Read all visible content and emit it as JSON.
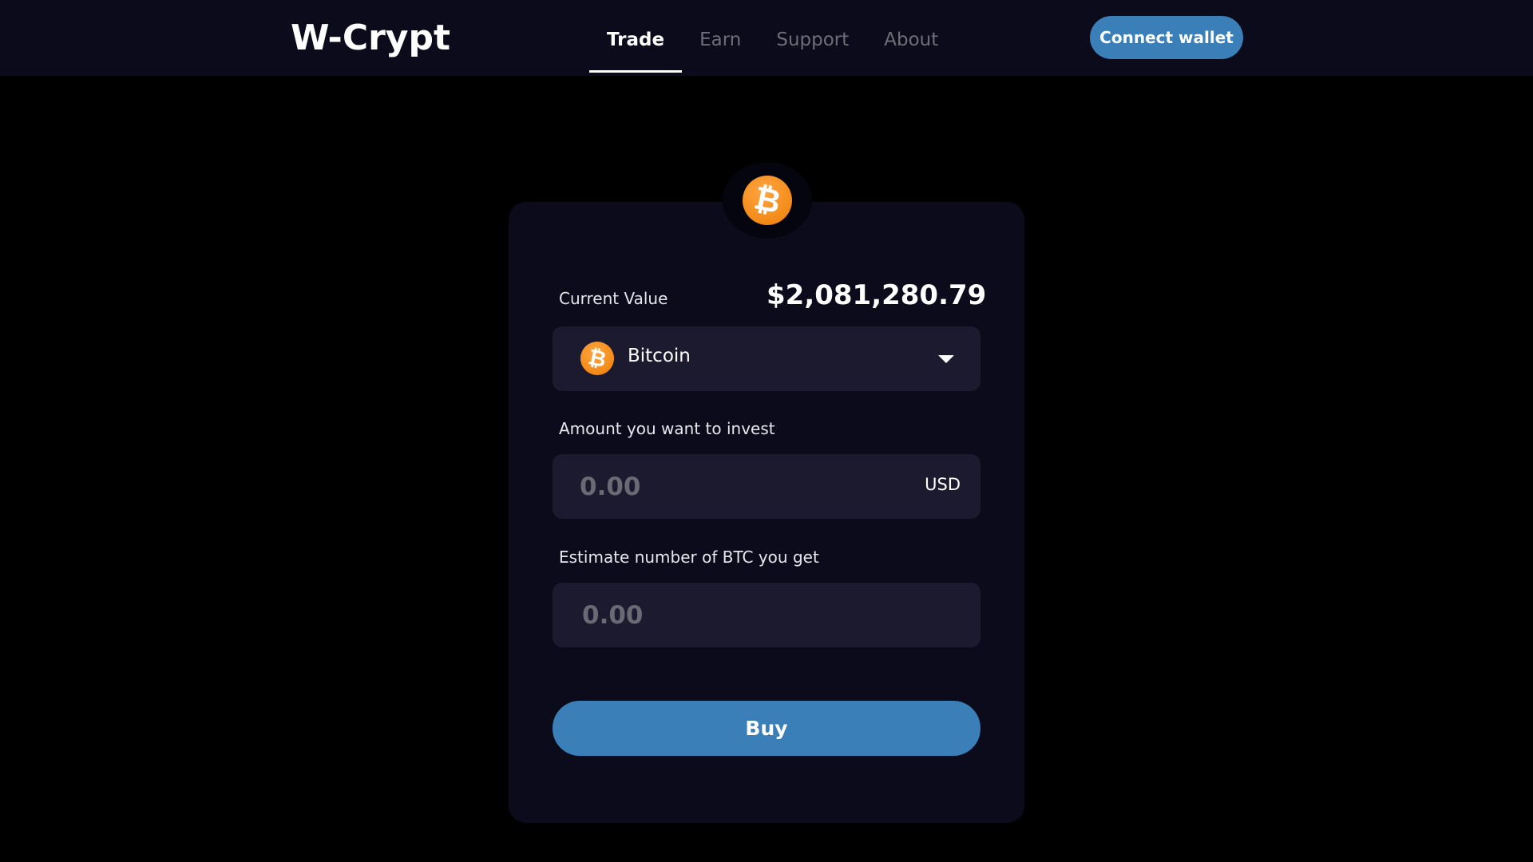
{
  "app": {
    "logo": "W-Crypt"
  },
  "nav": {
    "items": [
      {
        "label": "Trade",
        "active": true
      },
      {
        "label": "Earn",
        "active": false
      },
      {
        "label": "Support",
        "active": false
      },
      {
        "label": "About",
        "active": false
      }
    ],
    "connect_label": "Connect wallet"
  },
  "trade": {
    "current_value_label": "Current Value",
    "current_value": "$2,081,280.79",
    "coin_icon": "bitcoin-icon",
    "coin_symbol": "₿",
    "selected_coin": "Bitcoin",
    "invest_label": "Amount you want to invest",
    "invest_placeholder": "0.00",
    "invest_currency": "USD",
    "estimate_label": "Estimate number of BTC you get",
    "estimate_placeholder": "0.00",
    "buy_label": "Buy"
  },
  "colors": {
    "accent": "#3a7fb8",
    "bitcoin_orange": "#f7931a",
    "navbar": "#0c0b1c",
    "card": "#0c0b1c",
    "field": "#1c1a2f",
    "background": "#000000"
  }
}
